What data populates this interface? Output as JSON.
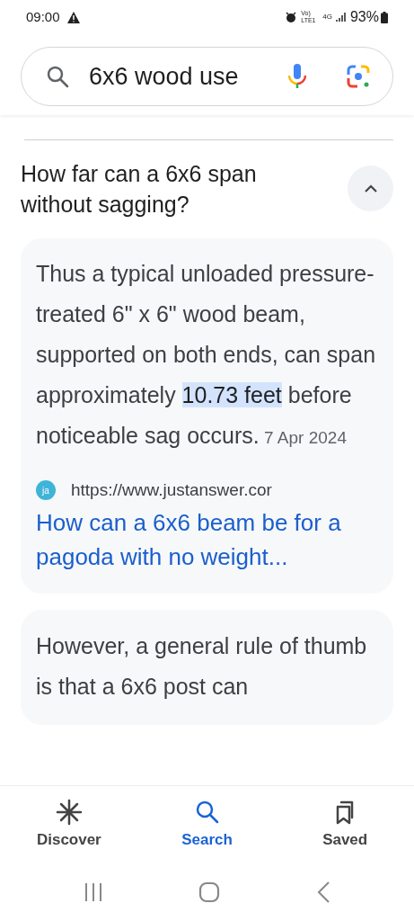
{
  "status_bar": {
    "time": "09:00",
    "network": "Vo) LTE1",
    "data": "4G",
    "battery": "93%"
  },
  "search": {
    "value": "6x6 wood use"
  },
  "question": {
    "text": "How far can a 6x6 span without sagging?",
    "expanded": true
  },
  "answer": {
    "segments": [
      {
        "text": "Thus a typical unloaded pressure-treated 6\" x 6\" wood beam, supported on both ends, can span approximately ",
        "highlighted": false
      },
      {
        "text": "10.73 feet",
        "highlighted": true
      },
      {
        "text": " before noticeable sag occurs.",
        "highlighted": false
      }
    ],
    "date": "7 Apr 2024",
    "source_icon": "ja",
    "url": "https://www.justanswer.cor",
    "link": "How can a 6x6 beam be for a pagoda with no weight..."
  },
  "next_answer": {
    "text": "However, a general rule of thumb is that a 6x6 post can"
  },
  "bottom_nav": [
    {
      "label": "Discover",
      "selected": false
    },
    {
      "label": "Search",
      "selected": true
    },
    {
      "label": "Saved",
      "selected": false
    }
  ]
}
